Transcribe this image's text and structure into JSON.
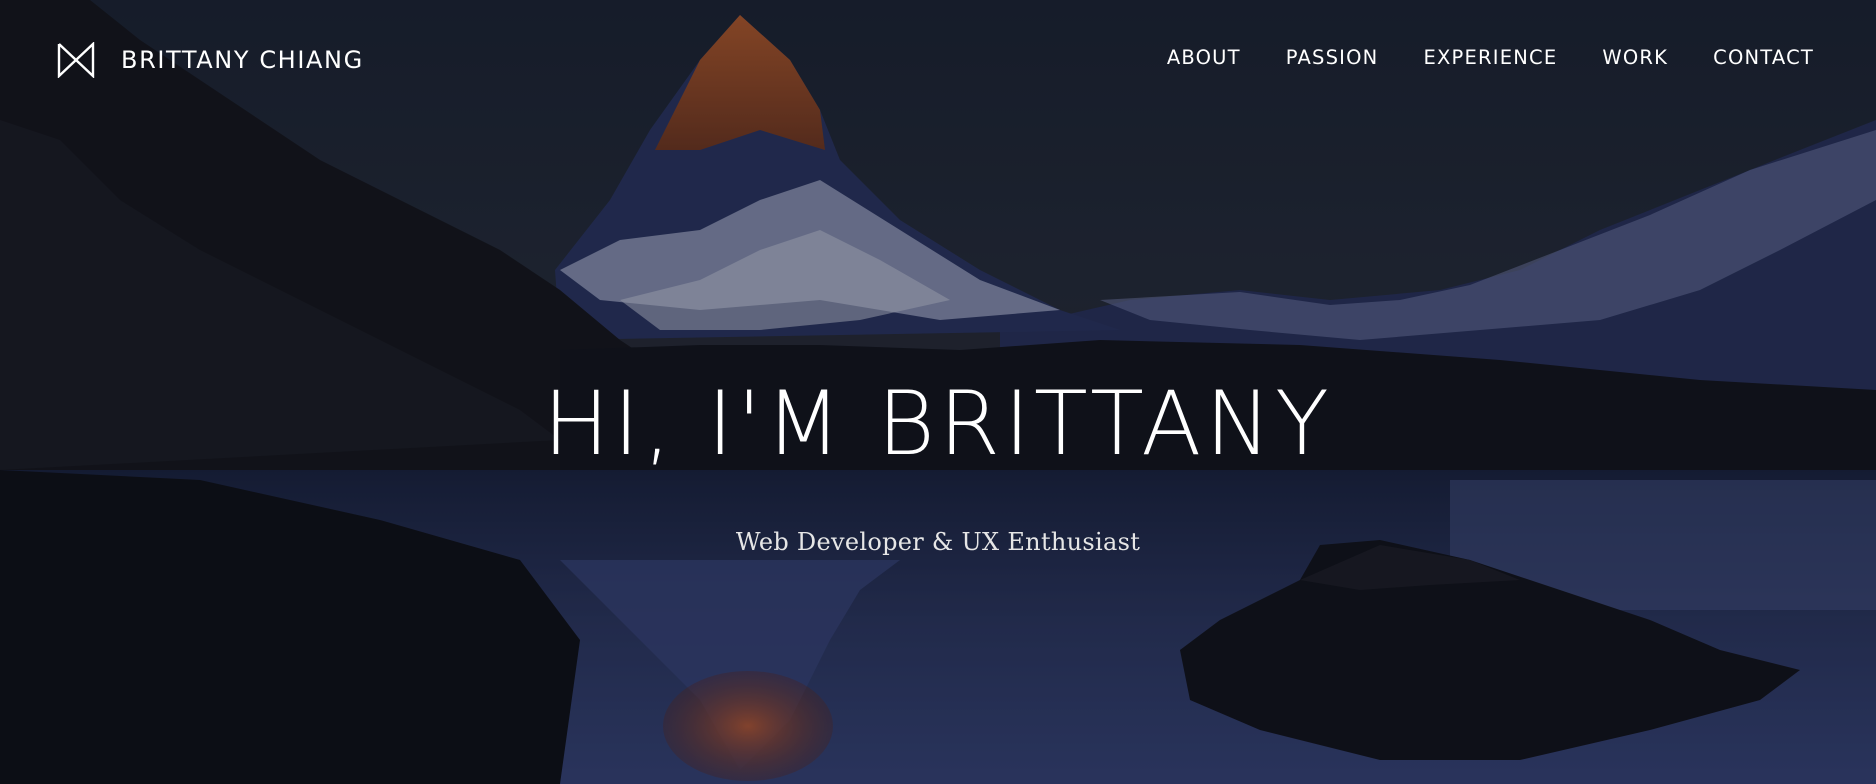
{
  "brand": {
    "name": "BRITTANY CHIANG",
    "logo_icon": "bowtie-logo-icon"
  },
  "nav": {
    "items": [
      "ABOUT",
      "PASSION",
      "EXPERIENCE",
      "WORK",
      "CONTACT"
    ]
  },
  "hero": {
    "headline": "HI, I'M BRITTANY",
    "subtitle": "Web Developer & UX Enthusiast",
    "background": "mountain-lake-night-photo"
  },
  "colors": {
    "text": "#ffffff",
    "overlay": "#0b0f1a",
    "peak_glow": "#d9622b",
    "water": "#3b4a7a"
  }
}
